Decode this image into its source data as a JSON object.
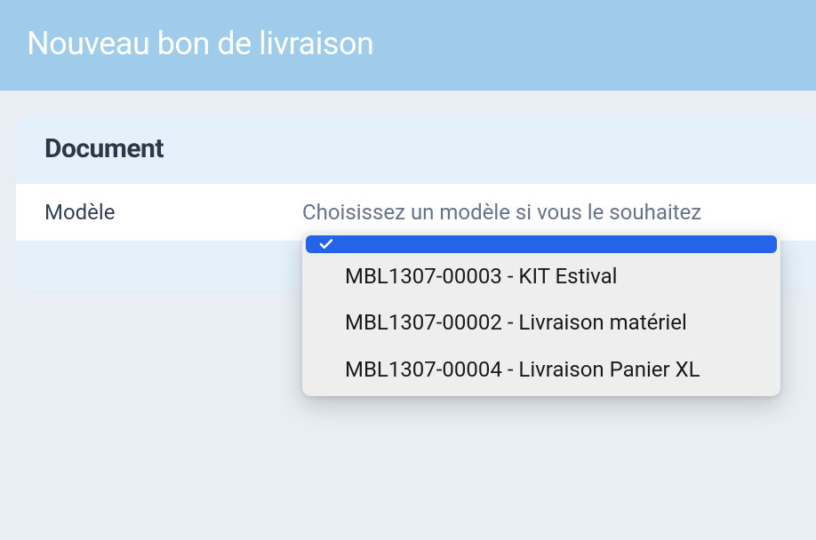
{
  "header": {
    "title": "Nouveau bon de livraison"
  },
  "card": {
    "section_title": "Document",
    "field_label": "Modèle",
    "dropdown": {
      "placeholder": "Choisissez un modèle si vous le souhaitez",
      "selected_index": 0,
      "options": [
        {
          "label": ""
        },
        {
          "label": "MBL1307-00003 - KIT Estival"
        },
        {
          "label": "MBL1307-00002 - Livraison matériel"
        },
        {
          "label": "MBL1307-00004 - Livraison Panier XL"
        }
      ]
    }
  }
}
